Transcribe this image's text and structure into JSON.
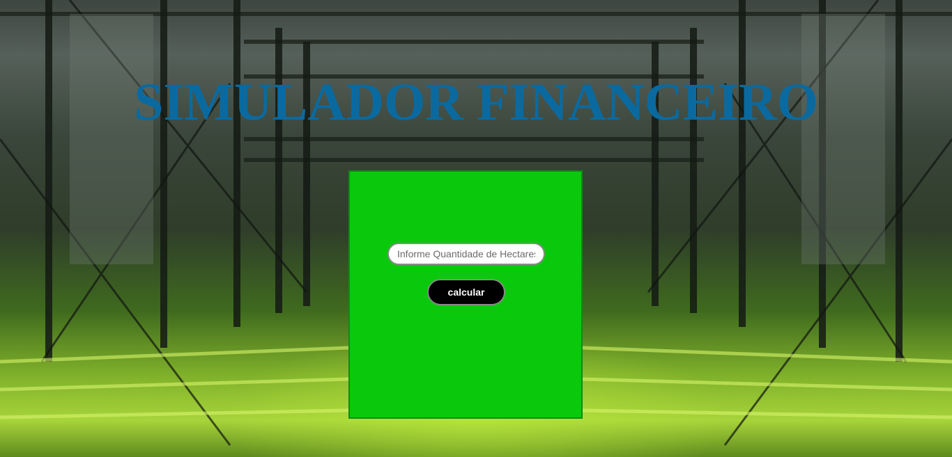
{
  "page": {
    "title": "SIMULADOR FINANCEIRO"
  },
  "form": {
    "hectares_placeholder": "Informe Quantidade de Hectares",
    "hectares_value": "",
    "calculate_label": "calcular"
  },
  "colors": {
    "title": "#0a6aa0",
    "panel_background": "#0ac90c",
    "button_background": "#000000",
    "button_text": "#ffffff"
  }
}
